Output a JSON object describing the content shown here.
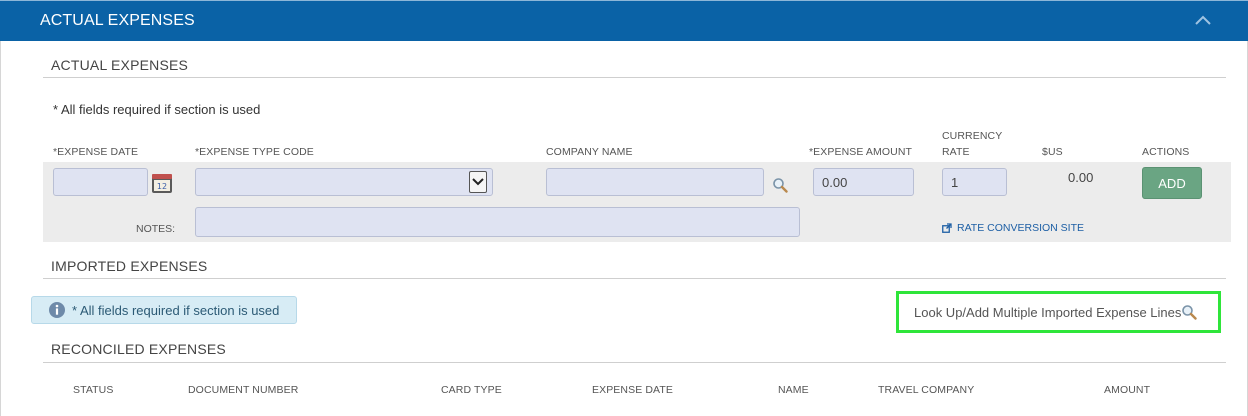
{
  "panel": {
    "title": "ACTUAL EXPENSES"
  },
  "actual_expenses": {
    "heading": "ACTUAL EXPENSES",
    "required_note": "* All fields required if section is used",
    "columns": {
      "expense_date": "*EXPENSE DATE",
      "expense_type_code": "*EXPENSE TYPE CODE",
      "company_name": "COMPANY NAME",
      "expense_amount": "*EXPENSE AMOUNT",
      "currency_rate_line1": "CURRENCY",
      "currency_rate_line2": "RATE",
      "usd": "$US",
      "actions": "ACTIONS"
    },
    "fields": {
      "expense_date": "",
      "expense_type_code": "",
      "company_name": "",
      "expense_amount": "0.00",
      "currency_rate": "1",
      "usd_value": "0.00",
      "notes": ""
    },
    "notes_label": "NOTES:",
    "add_button": "ADD",
    "rate_conversion_link": "RATE CONVERSION SITE"
  },
  "imported_expenses": {
    "heading": "IMPORTED EXPENSES",
    "info_note": "* All fields required if section is used",
    "lookup_link": "Look Up/Add Multiple Imported Expense Lines"
  },
  "reconciled_expenses": {
    "heading": "RECONCILED EXPENSES",
    "columns": [
      "STATUS",
      "DOCUMENT NUMBER",
      "CARD TYPE",
      "EXPENSE DATE",
      "NAME",
      "TRAVEL COMPANY",
      "AMOUNT"
    ]
  },
  "icons": {
    "collapse": "chevron-up-icon",
    "calendar": "calendar-icon",
    "search": "magnifier-icon",
    "external_link": "external-link-icon",
    "info": "info-icon"
  },
  "colors": {
    "header_bg": "#0a62a6",
    "field_bg": "#dfe3f2",
    "add_button_bg": "#6aa583",
    "highlight_border": "#2fe53a",
    "info_bg": "#d7ecf5"
  }
}
